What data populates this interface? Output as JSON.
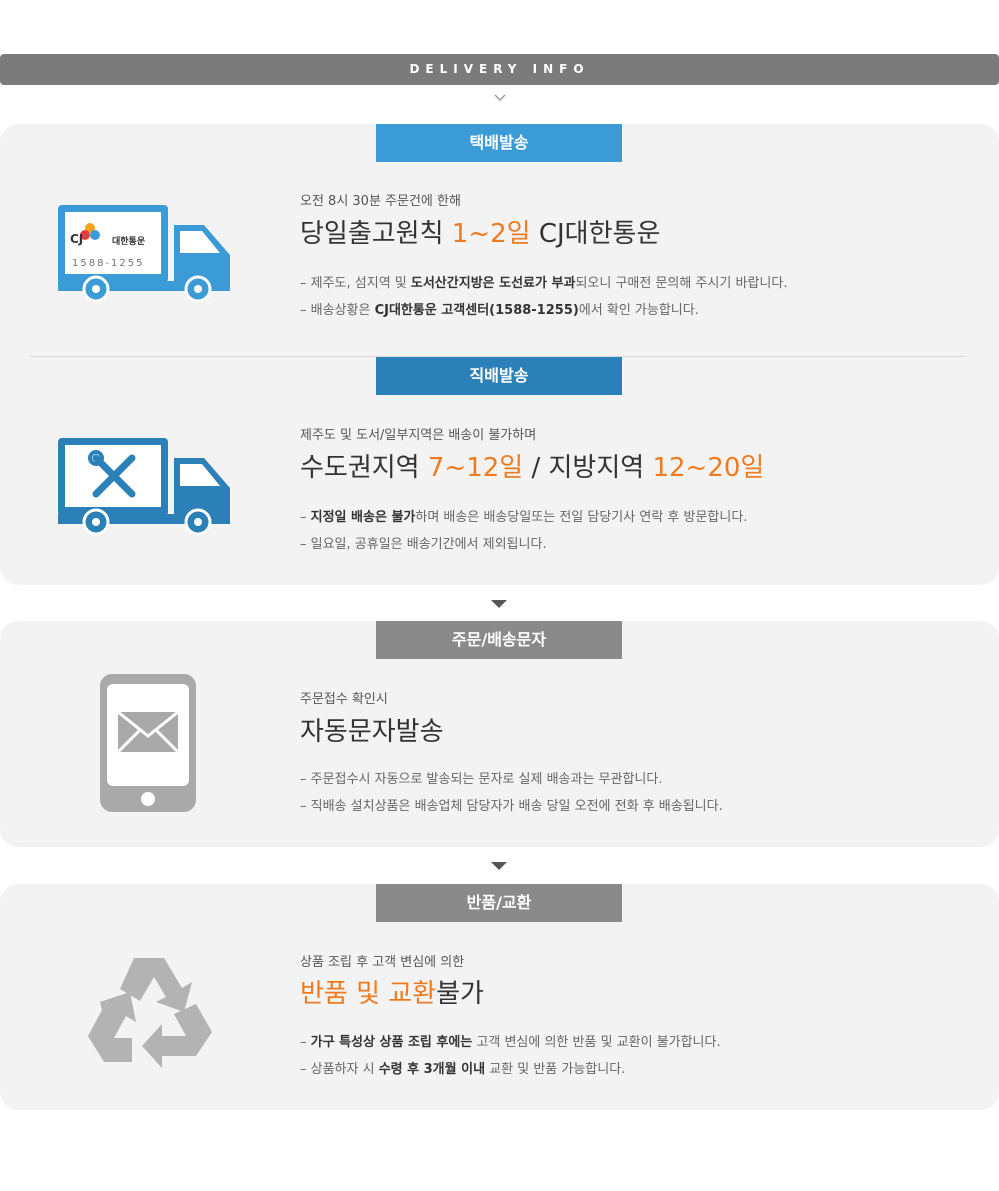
{
  "header": {
    "title": "DELIVERY INFO"
  },
  "colors": {
    "accent_orange": "#f07b1e",
    "banner_blue": "#3a9bd6",
    "banner_darkblue": "#2b80b8",
    "banner_gray": "#8a8a8a",
    "icon_blue": "#3a9bd6",
    "icon_gray": "#a9a9a9"
  },
  "sections": [
    {
      "banner": "택배발송",
      "icon": "cj-delivery-truck-icon",
      "truck_logo": {
        "brand": "CJ",
        "name": "대한통운",
        "phone": "1588-1255"
      },
      "subtitle": "오전 8시 30분 주문건에 한해",
      "headline": {
        "a": "당일출고원칙 ",
        "b": "1~2일",
        "c": " CJ대한통운"
      },
      "lines": [
        {
          "p1": "– 제주도, 섬지역 및 ",
          "b1": "도서산간지방은 도선료가 부과",
          "p2": "되오니 구매전 문의해 주시기 바랍니다."
        },
        {
          "p1": "– 배송상황은 ",
          "b1": "CJ대한통운 고객센터(1588-1255)",
          "p2": "에서 확인 가능합니다."
        }
      ]
    },
    {
      "banner": "직배발송",
      "icon": "tools-truck-icon",
      "subtitle": "제주도 및 도서/일부지역은 배송이 불가하며",
      "headline": {
        "a": "수도권지역 ",
        "b": "7~12일",
        "c": " / 지방지역 ",
        "d": "12~20일"
      },
      "lines": [
        {
          "p1": "– ",
          "b1": "지정일 배송은 불가",
          "p2": "하며 배송은 배송당일또는 전일 담당기사 연락 후 방문합니다."
        },
        {
          "p1": "– 일요일, 공휴일은 배송기간에서 제외됩니다.",
          "b1": "",
          "p2": ""
        }
      ]
    },
    {
      "banner": "주문/배송문자",
      "icon": "phone-message-icon",
      "subtitle": "주문접수 확인시",
      "headline": {
        "a": "자동문자발송"
      },
      "lines": [
        {
          "p1": "– 주문접수시 자동으로 발송되는 문자로 실제 배송과는 무관합니다.",
          "b1": "",
          "p2": ""
        },
        {
          "p1": "– 직배송 설치상품은 배송업체 담당자가 배송 당일 오전에 전화 후 배송됩니다.",
          "b1": "",
          "p2": ""
        }
      ]
    },
    {
      "banner": "반품/교환",
      "icon": "recycle-icon",
      "subtitle": "상품 조립 후 고객 변심에 의한",
      "headline": {
        "a": "반품 및 교환",
        "b": "불가"
      },
      "lines": [
        {
          "p1": "– ",
          "b1": "가구 특성상 상품 조립 후에는",
          "p2": " 고객 변심에 의한 반품 및 교환이 불가합니다."
        },
        {
          "p1": "– 상품하자 시 ",
          "b1": "수령 후 3개월 이내",
          "p2": " 교환 및 반품 가능합니다."
        }
      ]
    }
  ]
}
